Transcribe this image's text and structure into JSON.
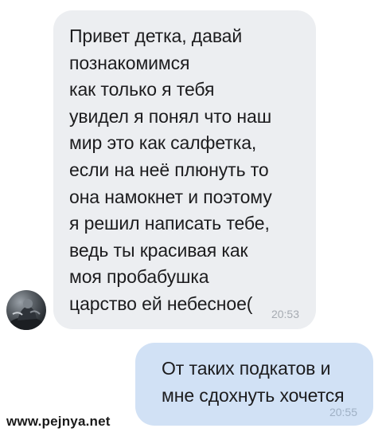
{
  "incoming_message": {
    "lines": [
      "Привет детка, давай",
      "познакомимся",
      "как только я тебя",
      "увидел я понял что наш",
      "мир это как салфетка,",
      "если на неё плюнуть то",
      "она намокнет и поэтому",
      "я решил написать тебе,",
      "ведь ты красивая как",
      "моя пробабушка",
      "царство ей небесное("
    ],
    "time": "20:53"
  },
  "outgoing_message": {
    "lines": [
      "От таких подкатов и",
      "мне сдохнуть хочется"
    ],
    "time": "20:55"
  },
  "watermark": "www.pejnya.net",
  "colors": {
    "incoming_bubble": "#eceef1",
    "outgoing_bubble": "#d1e1f5",
    "timestamp": "#a6abb2"
  }
}
